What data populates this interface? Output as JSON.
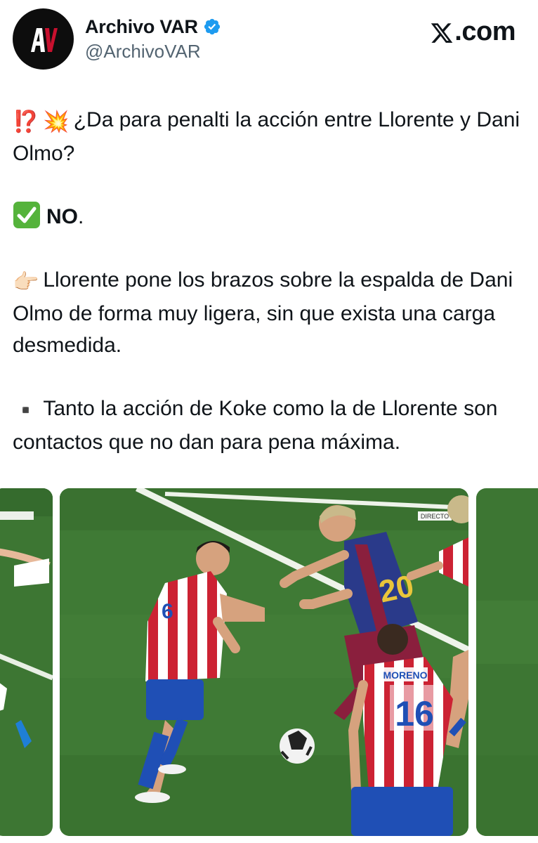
{
  "header": {
    "display_name": "Archivo VAR",
    "handle": "@ArchivoVAR",
    "brand": ".com",
    "avatar_icon": "archivo-var-logo-icon",
    "verified_icon": "verified-badge-icon",
    "brand_icon": "x-logo-icon",
    "colors": {
      "verified": "#1d9bf0",
      "avatar_bg": "#0d0d0d",
      "avatar_accent": "#c8102e"
    }
  },
  "tweet": {
    "line1_emojis": [
      "⁉️",
      "💥"
    ],
    "line1_text": "¿Da para penalti la acción entre Llorente y Dani Olmo?",
    "line2_emoji": "✅",
    "line2_bold": "NO",
    "line2_tail": ".",
    "line3_emoji": "👉🏻",
    "line3_text": "Llorente pone los brazos sobre la espalda de Dani Olmo de forma muy ligera, sin que exista una carga desmedida.",
    "line4_emoji": "▪️",
    "line4_text": "Tanto la acción de Koke como la de Llorente son contactos que no dan para pena máxima."
  },
  "media": {
    "broadcast_badge": "DIRECTO",
    "jersey_number_left": "6",
    "jersey_number_right": "16",
    "jersey_name_right": "MORENO",
    "jersey_number_barca": "20",
    "colors": {
      "pitch": "#3f7a35",
      "atleti_red": "#cc2233",
      "atleti_blue": "#1f4fb5",
      "barca_blue": "#2a3a8a",
      "barca_red": "#8a1f3d"
    }
  }
}
